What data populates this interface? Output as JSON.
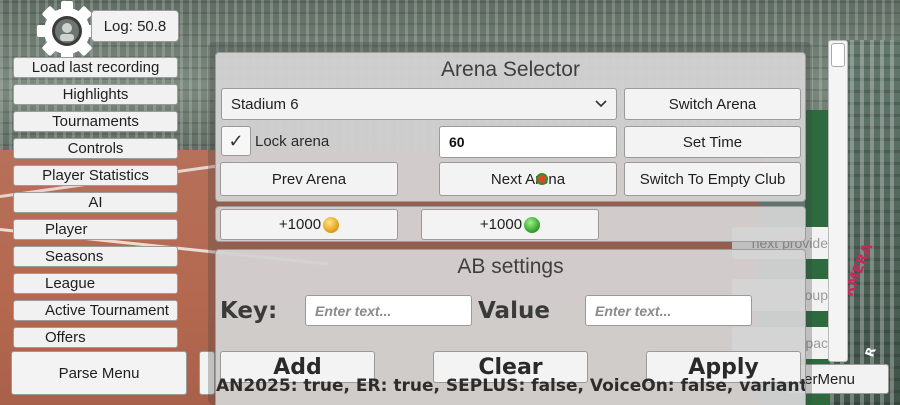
{
  "log": {
    "text": "Log: 50.8"
  },
  "menu": {
    "items": [
      {
        "label": "Load last recording"
      },
      {
        "label": "Highlights"
      },
      {
        "label": "Tournaments"
      },
      {
        "label": "Controls"
      },
      {
        "label": "Player Statistics"
      },
      {
        "label": "AI"
      },
      {
        "label": "Player"
      },
      {
        "label": "Seasons"
      },
      {
        "label": "League"
      },
      {
        "label": "Active Tournament"
      },
      {
        "label": "Offers"
      }
    ],
    "parse_label": "Parse Menu"
  },
  "arena": {
    "title": "Arena Selector",
    "selected_stadium": "Stadium 6",
    "switch_label": "Switch Arena",
    "lock_label": "Lock arena",
    "lock_checked": "✓",
    "time_value": "60",
    "set_time_label": "Set Time",
    "prev_label": "Prev Arena",
    "next_label": "Next Arena",
    "empty_club_label": "Switch To Empty Club"
  },
  "currency": {
    "coins_label": "+1000",
    "gems_label": "+1000",
    "coin_color": "#e6a51f",
    "gem_color": "#3aa832"
  },
  "ab_settings": {
    "title": "AB settings",
    "key_label": "Key:",
    "key_placeholder": "Enter text...",
    "value_label": "Value",
    "value_placeholder": "Enter text...",
    "add_label": "Add",
    "clear_label": "Clear",
    "apply_label": "Apply",
    "status": "AN2025: true, ER: true, SEPLUS: false, VoiceOn: false, variant:"
  },
  "right_panel": {
    "next_provider": "next provide",
    "item2": "oup",
    "item3": "pac",
    "menu_btn": "erMenu"
  },
  "background": {
    "logo_pink": "RMERA",
    "logo_white": "R"
  }
}
